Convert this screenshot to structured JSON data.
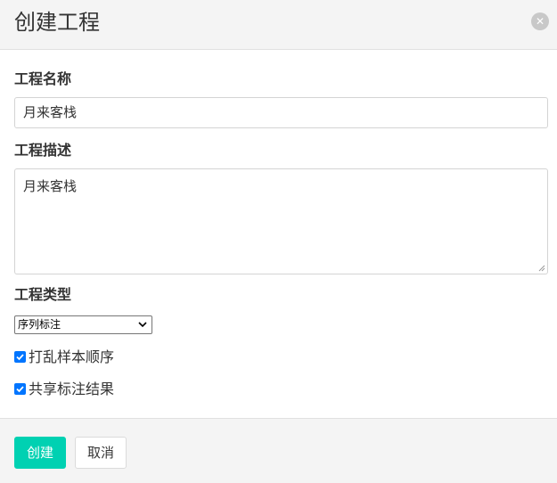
{
  "dialog": {
    "title": "创建工程",
    "close_icon": "close-icon"
  },
  "form": {
    "name_label": "工程名称",
    "name_value": "月来客栈",
    "description_label": "工程描述",
    "description_value": "月来客栈",
    "type_label": "工程类型",
    "type_selected": "序列标注",
    "checkboxes": [
      {
        "label": "打乱样本顺序",
        "checked": true
      },
      {
        "label": "共享标注结果",
        "checked": true
      }
    ]
  },
  "footer": {
    "create_label": "创建",
    "cancel_label": "取消"
  },
  "colors": {
    "primary": "#00d1b2",
    "checkbox": "#0075ff",
    "header_bg": "#f4f4f4"
  }
}
